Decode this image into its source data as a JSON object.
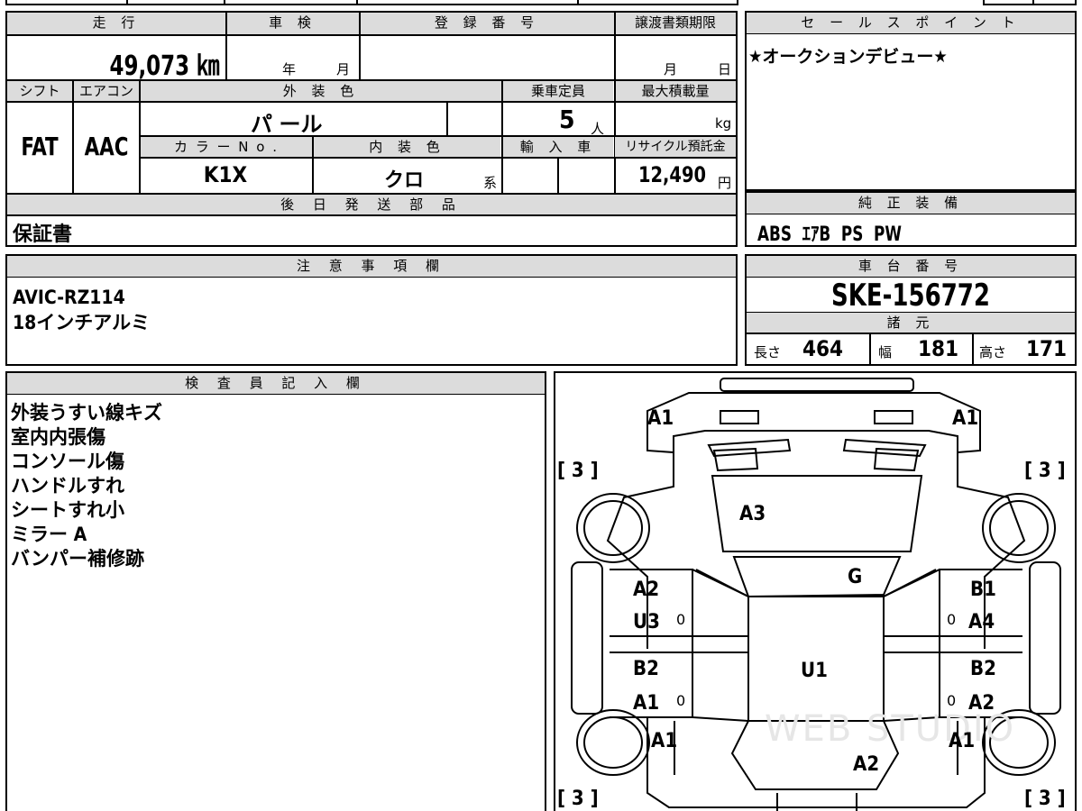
{
  "top_table": {
    "mileage_label": "走 行",
    "mileage_value": "49,073 ㎞",
    "inspection_label": "車 検",
    "inspection_year": "年",
    "inspection_month": "月",
    "registration_label": "登 録 番 号",
    "transfer_label": "譲渡書類期限",
    "transfer_month": "月",
    "transfer_day": "日",
    "shift_label": "シフト",
    "shift_value": "FAT",
    "aircon_label": "エアコン",
    "aircon_value": "AAC",
    "exterior_label": "外 装 色",
    "exterior_value": "パ ール",
    "capacity_label": "乗車定員",
    "capacity_value": "5",
    "capacity_unit": "人",
    "load_label": "最大積載量",
    "load_unit": "kg",
    "color_no_label": "カ ラ ー N o .",
    "color_no_value": "K1X",
    "interior_label": "内 装 色",
    "interior_value": "クロ",
    "interior_unit": "系",
    "import_label": "輸 入 車",
    "recycle_label": "リサイクル預託金",
    "recycle_value": "12,490",
    "recycle_unit": "円",
    "later_parts_label": "後 日 発 送 部 品",
    "later_parts_value": "保証書"
  },
  "sales_point": {
    "label": "セ ー ル ス ポ イ ン ト",
    "value": "★オークションデビュー★"
  },
  "genuine_equipment": {
    "label": "純 正 装 備",
    "value": "ABS  ｴｱB  PS  PW"
  },
  "notes": {
    "label": "注 意 事 項 欄",
    "lines": [
      "AVIC-RZ114",
      "18インチアルミ"
    ]
  },
  "chassis": {
    "label": "車 台 番 号",
    "value": "SKE-156772",
    "specs_label": "諸 元",
    "length_label": "長さ",
    "length_value": "464",
    "width_label": "幅",
    "width_value": "181",
    "height_label": "高さ",
    "height_value": "171"
  },
  "inspector": {
    "label": "検 査 員 記 入 欄",
    "lines": [
      "外装うすい線キズ",
      "室内内張傷",
      "コンソール傷",
      "ハンドルすれ",
      "シートすれ小",
      "ミラー A",
      "バンパー補修跡"
    ]
  },
  "diagram": {
    "front_left": "A1",
    "front_right": "A1",
    "tire_fl": "[ 3 ]",
    "tire_fr": "[ 3 ]",
    "tire_rl": "[ 3 ]",
    "tire_rr": "[ 3 ]",
    "hood": "A3",
    "windshield": "G",
    "front_left_door_1": "A2",
    "front_left_door_2": "U3",
    "front_right_door_1": "B1",
    "front_right_door_2": "A4",
    "roof": "U1",
    "rear_left_door_1": "B2",
    "rear_left_door_2": "A1",
    "rear_right_door_1": "B2",
    "rear_right_door_2": "A2",
    "rear_left_fender": "A1",
    "rear_right_fender": "A1",
    "rear": "A2",
    "small_mark": "0",
    "watermark": "WEB STUDIO"
  }
}
